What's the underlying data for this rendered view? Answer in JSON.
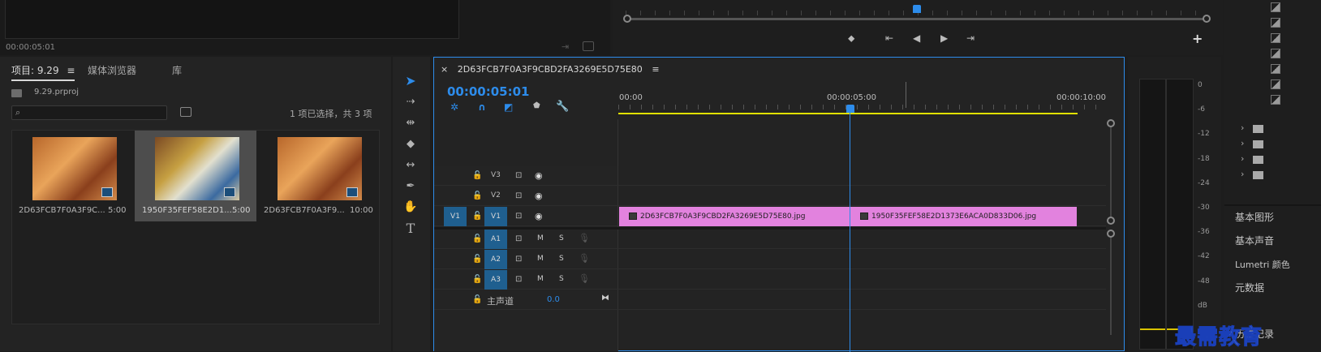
{
  "source_monitor": {
    "timecode": "00:00:05:01"
  },
  "project": {
    "tabs": [
      "项目: 9.29",
      "媒体浏览器",
      "库"
    ],
    "menu_glyph": "≡",
    "file": "9.29.prproj",
    "search_placeholder": "",
    "selection_info": "1 项已选择，共 3 项",
    "items": [
      {
        "name": "2D63FCB7F0A3F9C...",
        "duration": "5:00"
      },
      {
        "name": "1950F35FEF58E2D1...",
        "duration": "5:00"
      },
      {
        "name": "2D63FCB7F0A3F9...",
        "duration": "10:00"
      }
    ]
  },
  "sequence": {
    "close_glyph": "×",
    "name": "2D63FCB7F0A3F9CBD2FA3269E5D75E80",
    "menu_glyph": "≡",
    "timecode": "00:00:05:01",
    "ruler": [
      "00:00",
      "00:00:05:00",
      "00:00:10:00"
    ],
    "tracks_video": [
      "V3",
      "V2",
      "V1"
    ],
    "tracks_audio": [
      "A1",
      "A2",
      "A3"
    ],
    "src_patch": "V1",
    "mute": "M",
    "solo": "S",
    "master_label": "主声道",
    "master_value": "0.0",
    "clips": [
      {
        "name": "2D63FCB7F0A3F9CBD2FA3269E5D75E80.jpg"
      },
      {
        "name": "1950F35FEF58E2D1373E6ACA0D833D06.jpg"
      }
    ]
  },
  "meter": {
    "scale": [
      "0",
      "-6",
      "-12",
      "-18",
      "-24",
      "-30",
      "-36",
      "-42",
      "-48",
      "dB"
    ]
  },
  "right_panel": {
    "items": [
      "基本图形",
      "基本声音",
      "Lumetri 颜色",
      "元数据",
      "历史记录"
    ]
  },
  "watermark": "最需教育",
  "colors": {
    "accent": "#2d8ceb",
    "clip": "#e282de",
    "track_blue": "#1f5f8f",
    "work_area": "#e0e000"
  }
}
